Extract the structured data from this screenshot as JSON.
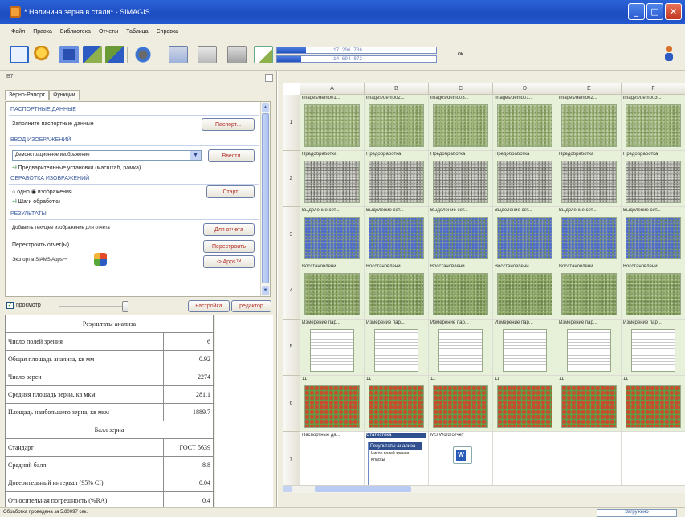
{
  "window": {
    "title": "* Наличина зерна в стали* - SIMAGIS"
  },
  "menu": [
    "Файл",
    "Правка",
    "Библиотека",
    "Отчеты",
    "Таблица",
    "Справка"
  ],
  "toolbar": {
    "progress": [
      {
        "text": "17 206 736",
        "fraction": 0.18
      },
      {
        "text": "14 694 872",
        "fraction": 0.15
      }
    ],
    "ok_label": "ок"
  },
  "left_panel": {
    "cell_ref": "B7",
    "tabs": [
      "Зерно-Рапорт",
      "Функции"
    ],
    "sections": {
      "passport": "ПАСПОРТНЫЕ ДАННЫЕ",
      "passport_hint": "Заполните паспортные данные",
      "passport_button": "Паспорт...",
      "image_input": "ВВОД ИЗОБРАЖЕНИЙ",
      "image_combo": "Демонстрационное изображение",
      "image_button": "Ввести",
      "presets": "Предварительные установки (масштаб, рамка)",
      "processing": "ОБРАБОТКА ИЗОБРАЖЕНИЙ",
      "radio_one": "одно",
      "radio_many": "изображения",
      "start_button": "Старт",
      "steps": "Шаги обработки",
      "results": "РЕЗУЛЬТАТЫ",
      "add_image": "Добавить текущее изображение для отчета",
      "report_button": "Для отчета",
      "rebuild": "Перестроить отчет(ы)",
      "rebuild_button": "Перестроить",
      "export": "Экспорт в SIAMS Apps™",
      "export_button": "-> Apps™"
    },
    "preview_label": "просмотр",
    "settings_button": "настройка",
    "editor_button": "редактор"
  },
  "results_table": {
    "title": "Результаты анализа",
    "rows": [
      {
        "label": "Число полей зрения",
        "value": "6"
      },
      {
        "label": "Общая площадь анализа, кв мм",
        "value": "0.92"
      },
      {
        "label": "Число зерен",
        "value": "2274"
      },
      {
        "label": "Средняя площадь зерна, кв мкм",
        "value": "281.1"
      },
      {
        "label": "Площадь наибольшего зерна, кв мкм",
        "value": "1889.7"
      }
    ],
    "subtitle": "Балл зерна",
    "rows2": [
      {
        "label": "Стандарт",
        "value": "ГОСТ 5639"
      },
      {
        "label": "Средний балл",
        "value": "8.8"
      },
      {
        "label": "Доверительный интервал (95% CI)",
        "value": "0.04"
      },
      {
        "label": "Относительная погрешность (%RA)",
        "value": "0.4"
      }
    ]
  },
  "grid": {
    "columns": [
      "A",
      "B",
      "C",
      "D",
      "E",
      "F"
    ],
    "rows": [
      "1",
      "2",
      "3",
      "4",
      "5",
      "6",
      "7"
    ],
    "row_captions": [
      [
        "images/demo01...",
        "images/demo02...",
        "images/demo03...",
        "images/demo01...",
        "images/demo02...",
        "images/demo03..."
      ],
      [
        "Предобработка",
        "Предобработка",
        "Предобработка",
        "Предобработка",
        "Предобработка",
        "Предобработка"
      ],
      [
        "Выделение сет...",
        "Выделение сет...",
        "Выделение сет...",
        "Выделение сет...",
        "Выделение сет...",
        "Выделение сет..."
      ],
      [
        "Восстановлени...",
        "Восстановлени...",
        "Восстановлени...",
        "Восстановлени...",
        "Восстановлени...",
        "Восстановлени..."
      ],
      [
        "Измерение пар...",
        "Измерение пар...",
        "Измерение пар...",
        "Измерение пар...",
        "Измерение пар...",
        "Измерение пар..."
      ],
      [
        "11",
        "11",
        "11",
        "11",
        "11",
        "11"
      ],
      [
        "Паспортные да...",
        "Статистика",
        "MS Word отчет",
        "",
        "",
        ""
      ]
    ],
    "stat_box": {
      "title": "Статистика",
      "lines": [
        "Результаты анализа",
        "Число полей зрения",
        "Классы"
      ]
    }
  },
  "status": {
    "left": "Обработка проведена за 5.80097 сек.",
    "right": "Загружено"
  }
}
